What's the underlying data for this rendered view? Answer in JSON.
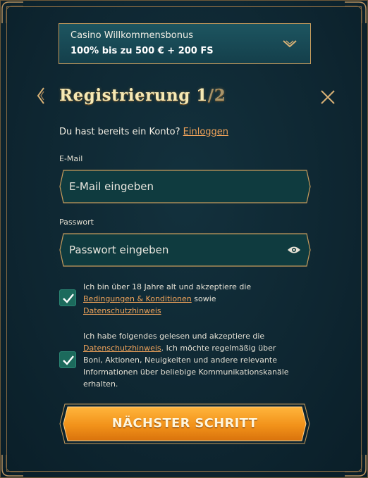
{
  "bonus": {
    "line1": "Casino Willkommensbonus",
    "line2": "100% bis zu 500 € + 200 FS",
    "chevron_icon": "chevron-down-icon"
  },
  "header": {
    "title": "Registrierung 1",
    "title_step": "/2",
    "back_icon": "arrow-left-icon",
    "close_icon": "close-icon"
  },
  "login": {
    "prompt": "Du hast bereits ein Konto?",
    "link": "Einloggen"
  },
  "email": {
    "label": "E-Mail",
    "placeholder": "E-Mail eingeben",
    "value": ""
  },
  "password": {
    "label": "Passwort",
    "placeholder": "Passwort eingeben",
    "value": "",
    "eye_icon": "eye-icon"
  },
  "consent1": {
    "checked": true,
    "text_before": "Ich bin über 18 Jahre alt und akzeptiere die ",
    "link_terms": "Bedingungen & Konditionen",
    "text_mid": " sowie ",
    "link_privacy": "Datenschutzhinweis"
  },
  "consent2": {
    "checked": true,
    "text_before": "Ich habe folgendes gelesen und akzeptiere die ",
    "link_privacy": "Datenschutzhinweis",
    "text_after": ". Ich möchte regelmäßig über Boni, Aktionen, Neuigkeiten und andere relevante Informationen über beliebige Kommunikationskanäle erhalten."
  },
  "submit": {
    "label": "NÄCHSTER SCHRITT"
  },
  "colors": {
    "accent_orange": "#f0a35a",
    "button_orange": "#f39a1c",
    "gold_border": "#c79c5c",
    "checkbox_green": "#1c6a5c",
    "background": "#0d2b38"
  }
}
